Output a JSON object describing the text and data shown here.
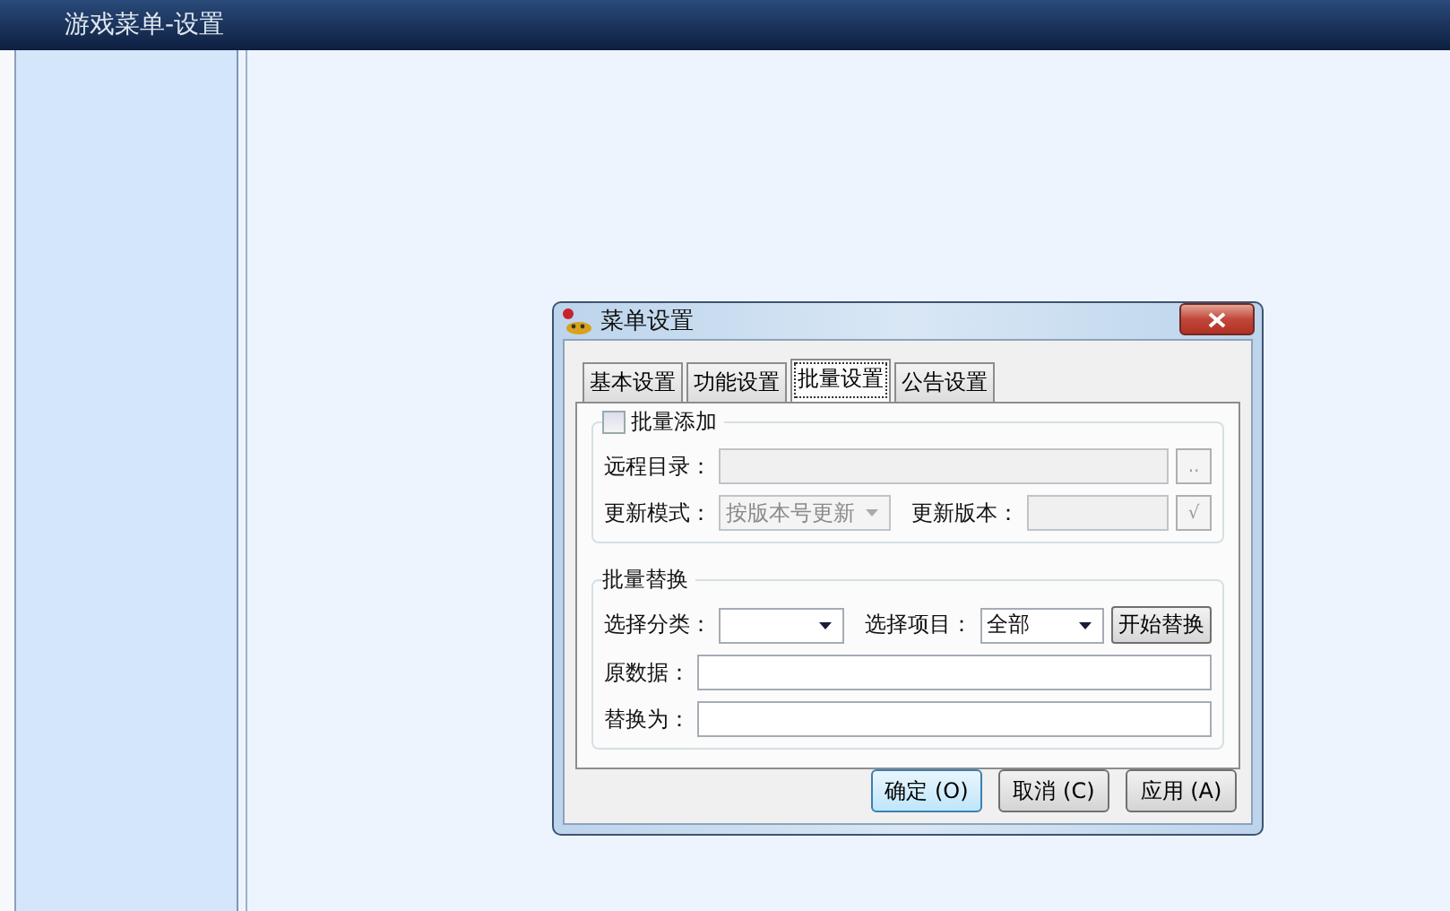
{
  "background_window": {
    "title": "游戏菜单-设置"
  },
  "dialog": {
    "title": "菜单设置",
    "tabs": [
      {
        "label": "基本设置",
        "selected": false
      },
      {
        "label": "功能设置",
        "selected": false
      },
      {
        "label": "批量设置",
        "selected": true
      },
      {
        "label": "公告设置",
        "selected": false
      }
    ],
    "batch_add": {
      "label": "批量添加",
      "checked": false,
      "disabled": true,
      "remote_dir": {
        "label": "远程目录：",
        "button": ".."
      },
      "update_mode": {
        "label": "更新模式：",
        "value": "按版本号更新"
      },
      "update_version": {
        "label": "更新版本：",
        "button": "√"
      }
    },
    "batch_replace": {
      "title": "批量替换",
      "category": {
        "label": "选择分类："
      },
      "item": {
        "label": "选择项目：",
        "value": "全部"
      },
      "start_button": "开始替换",
      "original": {
        "label": "原数据："
      },
      "replace_with": {
        "label": "替换为："
      }
    },
    "buttons": [
      {
        "label": "确定 (O)",
        "default": true
      },
      {
        "label": "取消 (C)",
        "default": false
      },
      {
        "label": "应用 (A)",
        "default": false
      }
    ]
  }
}
